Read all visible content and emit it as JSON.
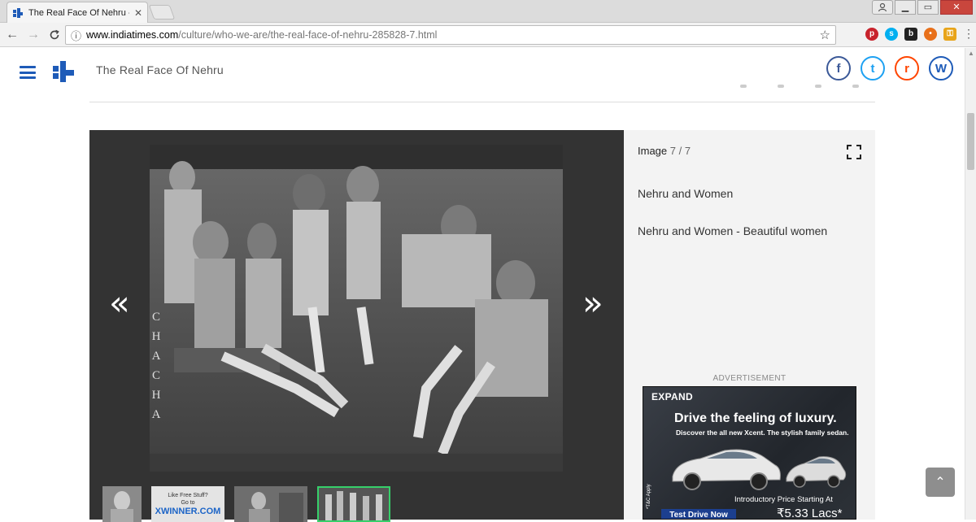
{
  "browser": {
    "tab_title": "The Real Face Of Nehru -",
    "tab_close": "✕",
    "url_host": "www.indiatimes.com",
    "url_path": "/culture/who-we-are/the-real-face-of-nehru-285828-7.html",
    "back": "←",
    "forward": "→",
    "reload": "C",
    "info": "ⓘ",
    "star": "☆",
    "win_min": "▁",
    "win_max": "▭",
    "win_close": "✕",
    "user": "👤"
  },
  "header": {
    "title": "The Real Face Of Nehru",
    "social": [
      "f",
      "t",
      "r",
      "W"
    ]
  },
  "gallery": {
    "prev": "«",
    "next": "»",
    "photo_text": [
      "C",
      "H",
      "A",
      "C",
      "H",
      "A"
    ],
    "thumb2_line1": "Like Free Stuff?",
    "thumb2_line2": "Go to",
    "thumb2_brand": "XWINNER.COM"
  },
  "side": {
    "image_label": "Image",
    "image_count": "7 / 7",
    "caption_title": "Nehru and Women",
    "caption_text": "Nehru and Women - Beautiful women",
    "ad_label": "ADVERTISEMENT"
  },
  "ad": {
    "expand": "EXPAND",
    "headline": "Drive the feeling of luxury.",
    "sub": "Discover the all new Xcent. The stylish family sedan.",
    "price_label": "Introductory Price Starting At",
    "price": "₹5.33 Lacs*",
    "cta": "Test Drive Now",
    "apply": "*T&C Apply"
  },
  "back_to_top": "⌃",
  "colors": {
    "brand_blue": "#1e5bb8",
    "gallery_bg": "#333333",
    "side_bg": "#f3f3f3",
    "active_thumb": "#36d06a"
  }
}
